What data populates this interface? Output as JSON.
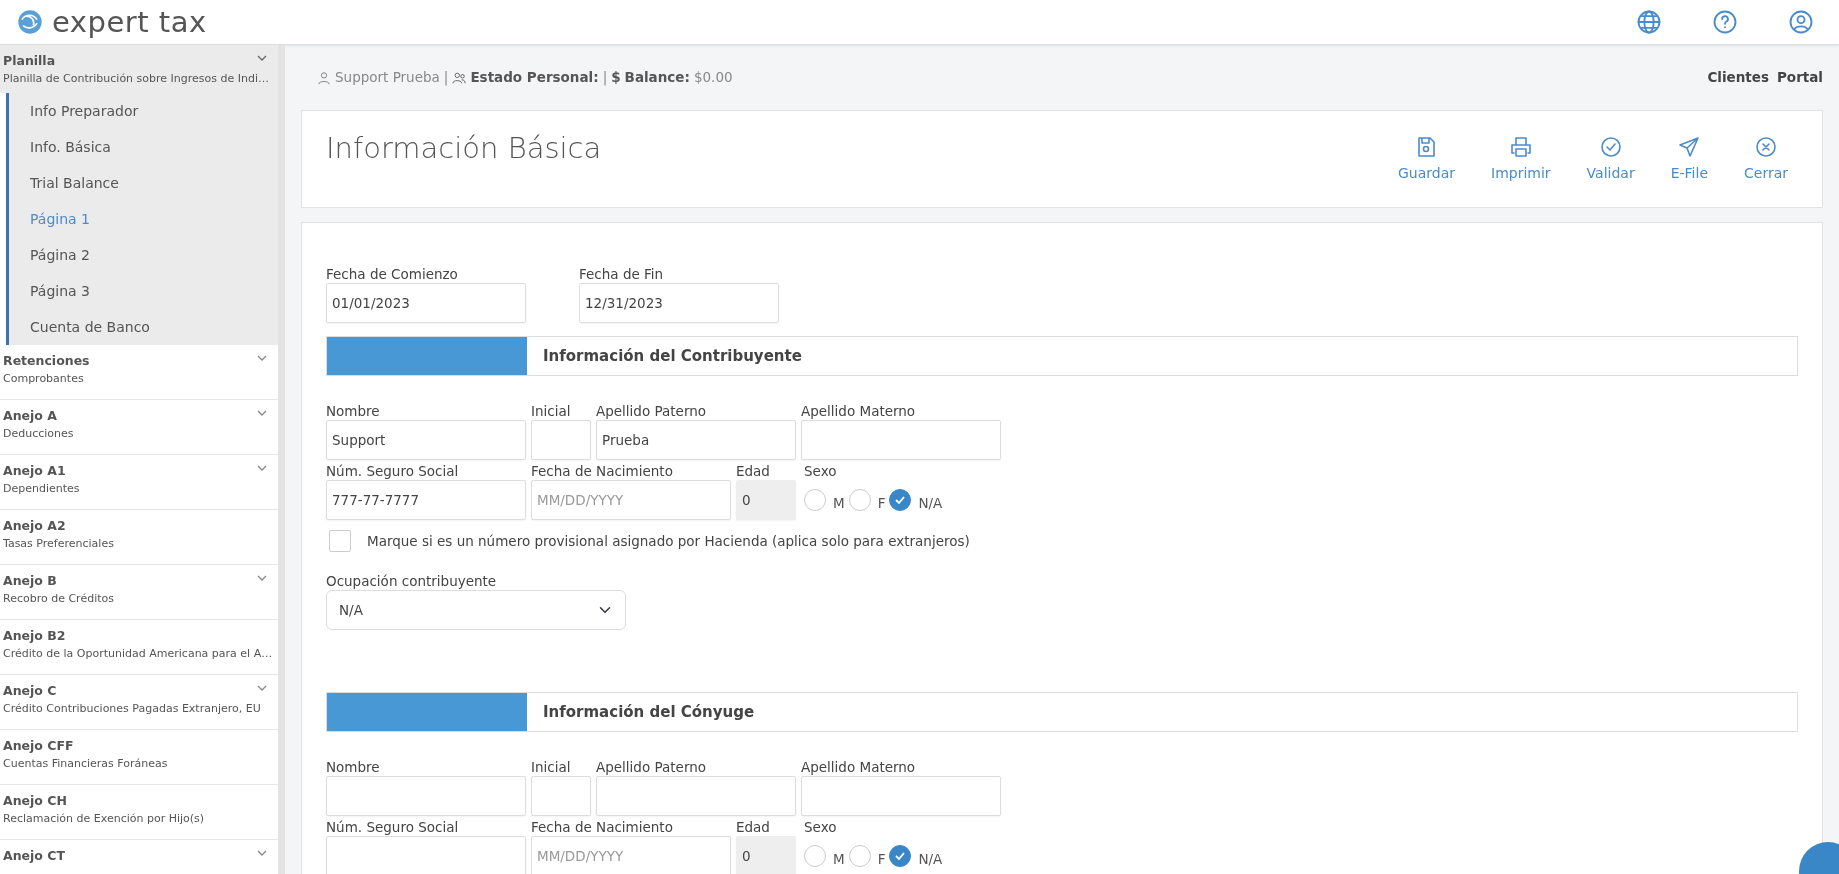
{
  "header": {
    "logo_text": "expert tax"
  },
  "sidebar": {
    "sections": [
      {
        "title": "Planilla",
        "subtitle": "Planilla de Contribución sobre Ingresos de Indi…",
        "expandable": true,
        "expanded": true,
        "children": [
          {
            "label": "Info Preparador",
            "selected": false
          },
          {
            "label": "Info. Básica",
            "selected": false
          },
          {
            "label": "Trial Balance",
            "selected": false
          },
          {
            "label": "Página 1",
            "selected": true
          },
          {
            "label": "Página 2",
            "selected": false
          },
          {
            "label": "Página 3",
            "selected": false
          },
          {
            "label": "Cuenta de Banco",
            "selected": false
          }
        ]
      },
      {
        "title": "Retenciones",
        "subtitle": "Comprobantes",
        "expandable": true,
        "expanded": false
      },
      {
        "title": "Anejo A",
        "subtitle": "Deducciones",
        "expandable": true,
        "expanded": false
      },
      {
        "title": "Anejo A1",
        "subtitle": "Dependientes",
        "expandable": true,
        "expanded": false
      },
      {
        "title": "Anejo A2",
        "subtitle": "Tasas Preferenciales",
        "expandable": false,
        "expanded": false
      },
      {
        "title": "Anejo B",
        "subtitle": "Recobro de Créditos",
        "expandable": true,
        "expanded": false
      },
      {
        "title": "Anejo B2",
        "subtitle": "Crédito de la Oportunidad Americana para el A…",
        "expandable": false,
        "expanded": false
      },
      {
        "title": "Anejo C",
        "subtitle": "Crédito Contribuciones Pagadas Extranjero, EU",
        "expandable": true,
        "expanded": false
      },
      {
        "title": "Anejo CFF",
        "subtitle": "Cuentas Financieras Foráneas",
        "expandable": false,
        "expanded": false
      },
      {
        "title": "Anejo CH",
        "subtitle": "Reclamación de Exención por Hijo(s)",
        "expandable": false,
        "expanded": false
      },
      {
        "title": "Anejo CT",
        "expandable": true,
        "expanded": false
      }
    ]
  },
  "info_bar": {
    "segments": [
      {
        "kind": "user",
        "text": "Support Prueba"
      },
      {
        "kind": "separator",
        "text": "|"
      },
      {
        "kind": "group",
        "text": "Estado Personal:"
      },
      {
        "kind": "separator",
        "text": "|"
      },
      {
        "kind": "money",
        "icon": "$",
        "text": "Balance:"
      },
      {
        "kind": "value",
        "text": "$0.00"
      }
    ],
    "links": [
      "Clientes",
      "Portal"
    ]
  },
  "toolbar": {
    "title": "Información Básica",
    "actions": [
      {
        "kind": "save",
        "label": "Guardar"
      },
      {
        "kind": "print",
        "label": "Imprimir"
      },
      {
        "kind": "validate",
        "label": "Validar"
      },
      {
        "kind": "efile",
        "label": "E-File"
      },
      {
        "kind": "close",
        "label": "Cerrar"
      }
    ]
  },
  "form": {
    "dates": [
      {
        "label": "Fecha de Comienzo",
        "value": "01/01/2023"
      },
      {
        "label": "Fecha de Fin",
        "value": "12/31/2023"
      }
    ],
    "sections": [
      {
        "title": "Información del Contribuyente",
        "fields": [
          {
            "kind": "text",
            "label": "Nombre",
            "value": "Support"
          },
          {
            "kind": "initial",
            "label": "Inicial"
          },
          {
            "kind": "text",
            "label": "Apellido Paterno",
            "value": "Prueba"
          },
          {
            "kind": "text",
            "label": "Apellido Materno"
          },
          {
            "kind": "text",
            "label": "Núm. Seguro Social",
            "value": "777-77-7777"
          },
          {
            "kind": "text",
            "label": "Fecha de Nacimiento",
            "placeholder": "MM/DD/YYYY"
          },
          {
            "kind": "age",
            "label": "Edad",
            "value": "0"
          },
          {
            "kind": "sex",
            "label": "Sexo",
            "options": [
              {
                "label": "M",
                "selected": false
              },
              {
                "label": "F",
                "selected": false
              },
              {
                "label": "N/A",
                "selected": true
              }
            ]
          }
        ],
        "checkbox": {
          "label": "Marque si es un número provisional asignado por Hacienda (aplica solo para extranjeros)",
          "checked": false
        },
        "select": {
          "label": "Ocupación contribuyente",
          "value": "N/A"
        }
      },
      {
        "title": "Información del Cónyuge",
        "fields": [
          {
            "kind": "text",
            "label": "Nombre"
          },
          {
            "kind": "initial",
            "label": "Inicial"
          },
          {
            "kind": "text",
            "label": "Apellido Paterno"
          },
          {
            "kind": "text",
            "label": "Apellido Materno"
          },
          {
            "kind": "text",
            "label": "Núm. Seguro Social"
          },
          {
            "kind": "text",
            "label": "Fecha de Nacimiento",
            "placeholder": "MM/DD/YYYY"
          },
          {
            "kind": "age",
            "label": "Edad",
            "value": "0"
          },
          {
            "kind": "sex",
            "label": "Sexo",
            "options": [
              {
                "label": "M",
                "selected": false
              },
              {
                "label": "F",
                "selected": false
              },
              {
                "label": "N/A",
                "selected": true
              }
            ]
          }
        ]
      }
    ]
  }
}
